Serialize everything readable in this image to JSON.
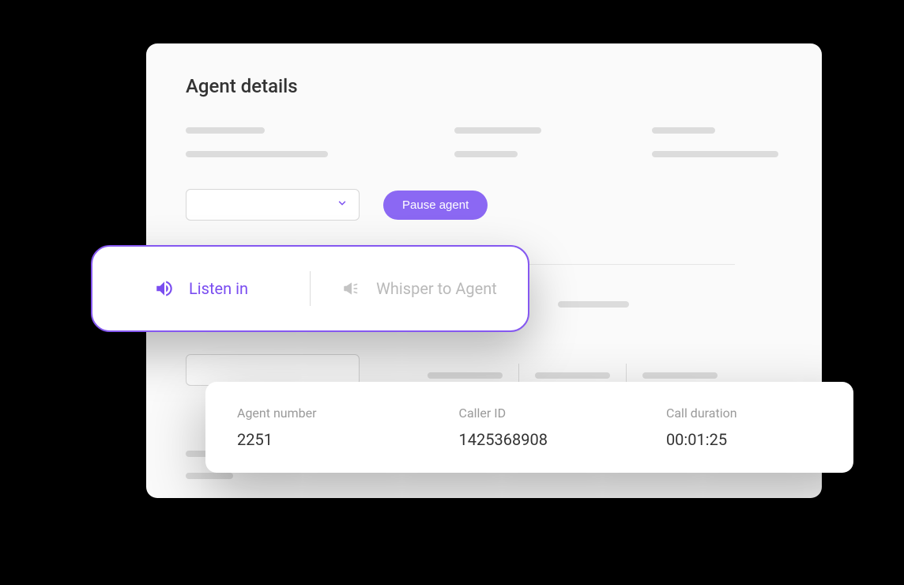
{
  "header": {
    "title": "Agent details"
  },
  "actions": {
    "pause_label": "Pause agent",
    "listen_label": "Listen in",
    "whisper_label": "Whisper to Agent"
  },
  "info": {
    "agent_number": {
      "label": "Agent number",
      "value": "2251"
    },
    "caller_id": {
      "label": "Caller ID",
      "value": "1425368908"
    },
    "duration": {
      "label": "Call duration",
      "value": "00:01:25"
    }
  },
  "colors": {
    "accent": "#8558f0"
  }
}
